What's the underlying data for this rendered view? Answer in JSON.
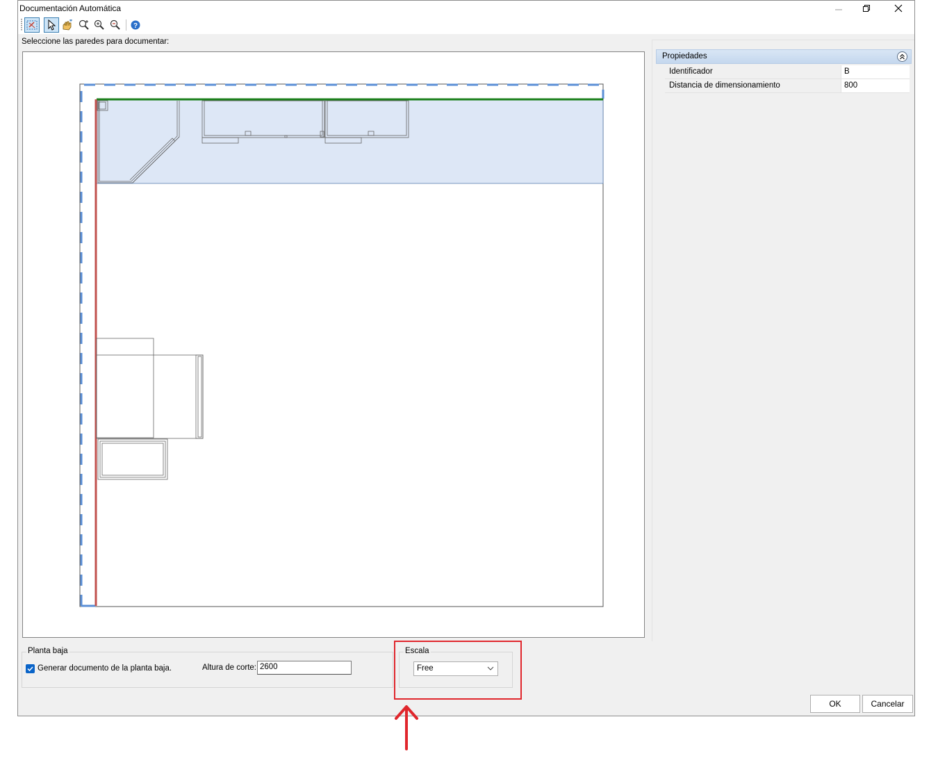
{
  "window": {
    "title": "Documentación Automática",
    "controls": [
      "minimize",
      "restore",
      "close"
    ]
  },
  "toolbar": {
    "buttons": [
      {
        "name": "select-walls-icon",
        "active": true
      },
      {
        "name": "pointer-icon",
        "active": true
      },
      {
        "name": "pan-hand-icon",
        "active": false
      },
      {
        "name": "zoom-extents-icon",
        "active": false
      },
      {
        "name": "zoom-in-icon",
        "active": false
      },
      {
        "name": "zoom-out-icon",
        "active": false
      },
      {
        "name": "help-icon",
        "active": false
      }
    ]
  },
  "prompt": "Seleccione las paredes para documentar:",
  "properties": {
    "title": "Propiedades",
    "rows": [
      {
        "name": "Identificador",
        "value": "B"
      },
      {
        "name": "Distancia de dimensionamiento",
        "value": "800"
      }
    ]
  },
  "ground_floor": {
    "group_label": "Planta baja",
    "checkbox_label": "Generar documento de la planta baja.",
    "checked": true,
    "cut_height_label": "Altura de corte:",
    "cut_height_value": "2600"
  },
  "scale": {
    "group_label": "Escala",
    "selected": "Free"
  },
  "buttons": {
    "ok": "OK",
    "cancel": "Cancelar"
  },
  "colors": {
    "accent": "#0a64c8",
    "selected_wall": "#1a7f1a",
    "other_wall": "#c0504d",
    "selection_dash": "#5b8fd6",
    "highlight": "#e0262c",
    "room_fill": "#dde7f6"
  }
}
